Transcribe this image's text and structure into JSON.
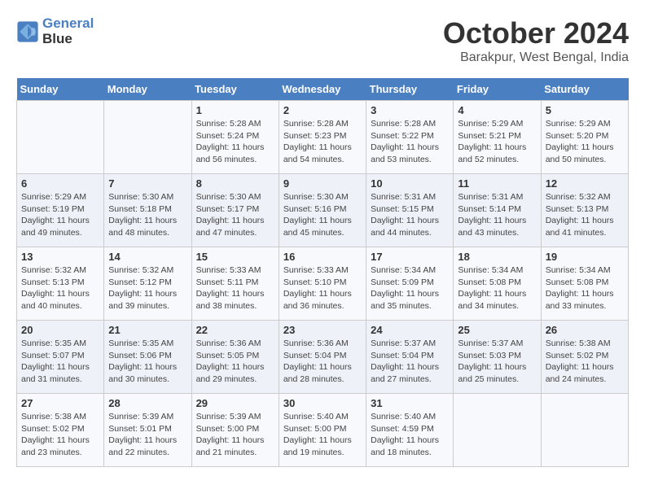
{
  "header": {
    "logo_line1": "General",
    "logo_line2": "Blue",
    "month_title": "October 2024",
    "location": "Barakpur, West Bengal, India"
  },
  "days_of_week": [
    "Sunday",
    "Monday",
    "Tuesday",
    "Wednesday",
    "Thursday",
    "Friday",
    "Saturday"
  ],
  "weeks": [
    [
      {
        "day": "",
        "detail": ""
      },
      {
        "day": "",
        "detail": ""
      },
      {
        "day": "1",
        "detail": "Sunrise: 5:28 AM\nSunset: 5:24 PM\nDaylight: 11 hours and 56 minutes."
      },
      {
        "day": "2",
        "detail": "Sunrise: 5:28 AM\nSunset: 5:23 PM\nDaylight: 11 hours and 54 minutes."
      },
      {
        "day": "3",
        "detail": "Sunrise: 5:28 AM\nSunset: 5:22 PM\nDaylight: 11 hours and 53 minutes."
      },
      {
        "day": "4",
        "detail": "Sunrise: 5:29 AM\nSunset: 5:21 PM\nDaylight: 11 hours and 52 minutes."
      },
      {
        "day": "5",
        "detail": "Sunrise: 5:29 AM\nSunset: 5:20 PM\nDaylight: 11 hours and 50 minutes."
      }
    ],
    [
      {
        "day": "6",
        "detail": "Sunrise: 5:29 AM\nSunset: 5:19 PM\nDaylight: 11 hours and 49 minutes."
      },
      {
        "day": "7",
        "detail": "Sunrise: 5:30 AM\nSunset: 5:18 PM\nDaylight: 11 hours and 48 minutes."
      },
      {
        "day": "8",
        "detail": "Sunrise: 5:30 AM\nSunset: 5:17 PM\nDaylight: 11 hours and 47 minutes."
      },
      {
        "day": "9",
        "detail": "Sunrise: 5:30 AM\nSunset: 5:16 PM\nDaylight: 11 hours and 45 minutes."
      },
      {
        "day": "10",
        "detail": "Sunrise: 5:31 AM\nSunset: 5:15 PM\nDaylight: 11 hours and 44 minutes."
      },
      {
        "day": "11",
        "detail": "Sunrise: 5:31 AM\nSunset: 5:14 PM\nDaylight: 11 hours and 43 minutes."
      },
      {
        "day": "12",
        "detail": "Sunrise: 5:32 AM\nSunset: 5:13 PM\nDaylight: 11 hours and 41 minutes."
      }
    ],
    [
      {
        "day": "13",
        "detail": "Sunrise: 5:32 AM\nSunset: 5:13 PM\nDaylight: 11 hours and 40 minutes."
      },
      {
        "day": "14",
        "detail": "Sunrise: 5:32 AM\nSunset: 5:12 PM\nDaylight: 11 hours and 39 minutes."
      },
      {
        "day": "15",
        "detail": "Sunrise: 5:33 AM\nSunset: 5:11 PM\nDaylight: 11 hours and 38 minutes."
      },
      {
        "day": "16",
        "detail": "Sunrise: 5:33 AM\nSunset: 5:10 PM\nDaylight: 11 hours and 36 minutes."
      },
      {
        "day": "17",
        "detail": "Sunrise: 5:34 AM\nSunset: 5:09 PM\nDaylight: 11 hours and 35 minutes."
      },
      {
        "day": "18",
        "detail": "Sunrise: 5:34 AM\nSunset: 5:08 PM\nDaylight: 11 hours and 34 minutes."
      },
      {
        "day": "19",
        "detail": "Sunrise: 5:34 AM\nSunset: 5:08 PM\nDaylight: 11 hours and 33 minutes."
      }
    ],
    [
      {
        "day": "20",
        "detail": "Sunrise: 5:35 AM\nSunset: 5:07 PM\nDaylight: 11 hours and 31 minutes."
      },
      {
        "day": "21",
        "detail": "Sunrise: 5:35 AM\nSunset: 5:06 PM\nDaylight: 11 hours and 30 minutes."
      },
      {
        "day": "22",
        "detail": "Sunrise: 5:36 AM\nSunset: 5:05 PM\nDaylight: 11 hours and 29 minutes."
      },
      {
        "day": "23",
        "detail": "Sunrise: 5:36 AM\nSunset: 5:04 PM\nDaylight: 11 hours and 28 minutes."
      },
      {
        "day": "24",
        "detail": "Sunrise: 5:37 AM\nSunset: 5:04 PM\nDaylight: 11 hours and 27 minutes."
      },
      {
        "day": "25",
        "detail": "Sunrise: 5:37 AM\nSunset: 5:03 PM\nDaylight: 11 hours and 25 minutes."
      },
      {
        "day": "26",
        "detail": "Sunrise: 5:38 AM\nSunset: 5:02 PM\nDaylight: 11 hours and 24 minutes."
      }
    ],
    [
      {
        "day": "27",
        "detail": "Sunrise: 5:38 AM\nSunset: 5:02 PM\nDaylight: 11 hours and 23 minutes."
      },
      {
        "day": "28",
        "detail": "Sunrise: 5:39 AM\nSunset: 5:01 PM\nDaylight: 11 hours and 22 minutes."
      },
      {
        "day": "29",
        "detail": "Sunrise: 5:39 AM\nSunset: 5:00 PM\nDaylight: 11 hours and 21 minutes."
      },
      {
        "day": "30",
        "detail": "Sunrise: 5:40 AM\nSunset: 5:00 PM\nDaylight: 11 hours and 19 minutes."
      },
      {
        "day": "31",
        "detail": "Sunrise: 5:40 AM\nSunset: 4:59 PM\nDaylight: 11 hours and 18 minutes."
      },
      {
        "day": "",
        "detail": ""
      },
      {
        "day": "",
        "detail": ""
      }
    ]
  ]
}
